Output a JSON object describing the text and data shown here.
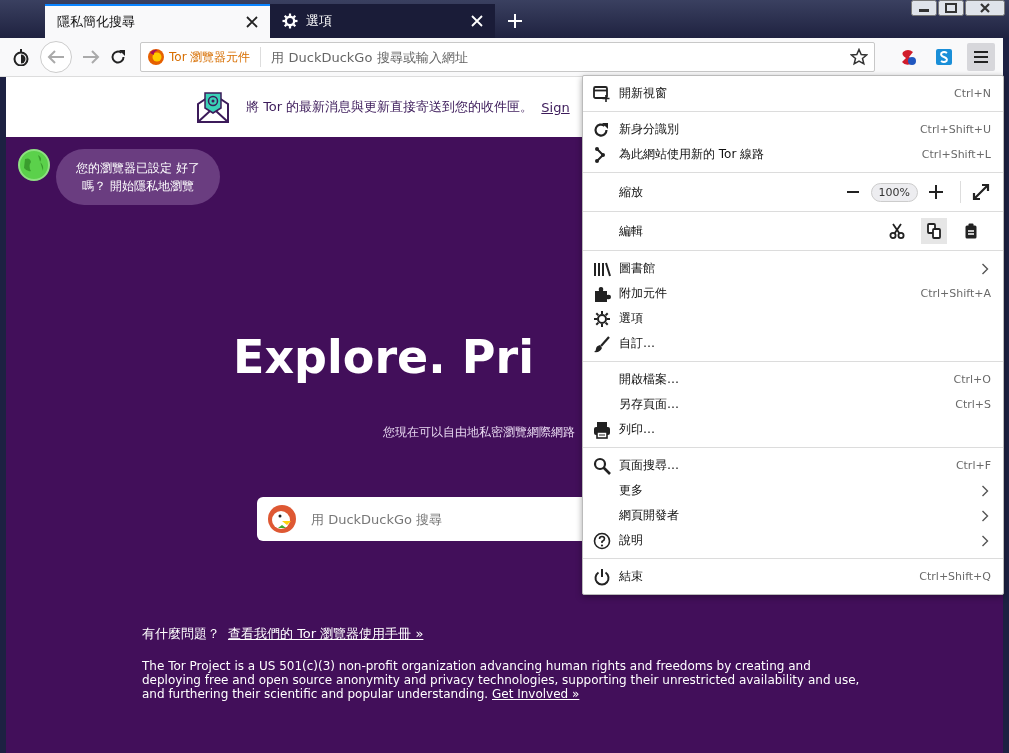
{
  "tabs": [
    {
      "kind": "page",
      "title": "隱私簡化搜尋",
      "selected": true
    },
    {
      "kind": "settings",
      "title": "選項",
      "selected": false
    }
  ],
  "toolbar": {
    "identity_label": "Tor 瀏覽器元件",
    "url_placeholder": "用 DuckDuckGo 搜尋或輸入網址"
  },
  "banner": {
    "text": "將 Tor 的最新消息與更新直接寄送到您的收件匣。",
    "link": "Sign"
  },
  "bubble": {
    "text": "您的瀏覽器已設定 好了嗎？ 開始隱私地瀏覽"
  },
  "hero": {
    "title": "Explore. Pri",
    "subtitle": "您現在可以自由地私密瀏覽網際網路"
  },
  "search": {
    "placeholder": "用 DuckDuckGo 搜尋"
  },
  "footer": {
    "question": "有什麼問題？",
    "manual_link": "查看我們的 Tor 瀏覽器使用手冊 »",
    "paragraph": "The Tor Project is a US 501(c)(3) non-profit organization advancing human rights and freedoms by creating and deploying free and open source anonymity and privacy technologies, supporting their unrestricted availability and use, and furthering their scientific and popular understanding.",
    "paragraph_link": "Get Involved »"
  },
  "menu": {
    "sections": [
      [
        {
          "kind": "item",
          "label": "開新視窗",
          "shortcut": "Ctrl+N",
          "submenu": false
        }
      ],
      [
        {
          "kind": "item",
          "label": "新身分識別",
          "shortcut": "Ctrl+Shift+U",
          "submenu": false
        },
        {
          "kind": "item",
          "label": "為此網站使用新的 Tor 線路",
          "shortcut": "Ctrl+Shift+L",
          "submenu": false
        }
      ],
      [
        {
          "kind": "zoom",
          "label": "縮放",
          "value": "100%"
        }
      ],
      [
        {
          "kind": "edit",
          "label": "編輯"
        }
      ],
      [
        {
          "kind": "item",
          "label": "圖書館",
          "submenu": true
        },
        {
          "kind": "item",
          "label": "附加元件",
          "shortcut": "Ctrl+Shift+A",
          "submenu": false
        },
        {
          "kind": "item",
          "label": "選項",
          "submenu": false
        },
        {
          "kind": "item",
          "label": "自訂…",
          "submenu": false
        }
      ],
      [
        {
          "kind": "item",
          "label": "開啟檔案…",
          "shortcut": "Ctrl+O",
          "submenu": false
        },
        {
          "kind": "item",
          "label": "另存頁面…",
          "shortcut": "Ctrl+S",
          "submenu": false
        },
        {
          "kind": "item",
          "label": "列印…",
          "submenu": false
        }
      ],
      [
        {
          "kind": "item",
          "label": "頁面搜尋…",
          "shortcut": "Ctrl+F",
          "submenu": false
        },
        {
          "kind": "item",
          "label": "更多",
          "submenu": true
        },
        {
          "kind": "item",
          "label": "網頁開發者",
          "submenu": true
        },
        {
          "kind": "item",
          "label": "說明",
          "submenu": true
        }
      ],
      [
        {
          "kind": "item",
          "label": "結束",
          "shortcut": "Ctrl+Shift+Q",
          "submenu": false
        }
      ]
    ]
  }
}
